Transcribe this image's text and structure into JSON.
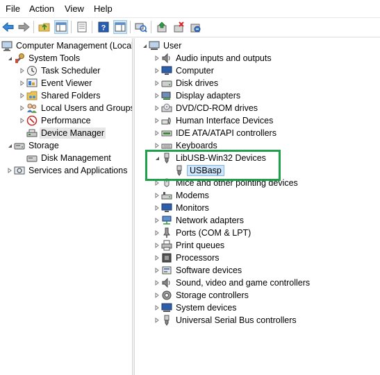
{
  "menubar": {
    "items": [
      "File",
      "Action",
      "View",
      "Help"
    ]
  },
  "toolbar": {
    "buttons": [
      "back-icon",
      "forward-icon",
      "up-folder-icon",
      "show-hide-tree-icon",
      "properties-icon",
      "help-icon",
      "action-pane-icon",
      "scan-hardware-icon",
      "update-driver-icon",
      "disable-device-icon",
      "uninstall-device-icon"
    ]
  },
  "left_tree": {
    "root": "Computer Management (Local",
    "system_tools": "System Tools",
    "task_scheduler": "Task Scheduler",
    "event_viewer": "Event Viewer",
    "shared_folders": "Shared Folders",
    "local_users": "Local Users and Groups",
    "performance": "Performance",
    "device_manager": "Device Manager",
    "storage": "Storage",
    "disk_management": "Disk Management",
    "services_apps": "Services and Applications"
  },
  "device_tree": {
    "root": "User",
    "categories": [
      "Audio inputs and outputs",
      "Computer",
      "Disk drives",
      "Display adapters",
      "DVD/CD-ROM drives",
      "Human Interface Devices",
      "IDE ATA/ATAPI controllers",
      "Keyboards",
      "LibUSB-Win32 Devices",
      "Mice and other pointing devices",
      "Modems",
      "Monitors",
      "Network adapters",
      "Ports (COM & LPT)",
      "Print queues",
      "Processors",
      "Software devices",
      "Sound, video and game controllers",
      "Storage controllers",
      "System devices",
      "Universal Serial Bus controllers"
    ],
    "expanded_child": "USBasp"
  },
  "colors": {
    "highlight_box": "#1fa04a",
    "selection": "#cfe5fb"
  }
}
